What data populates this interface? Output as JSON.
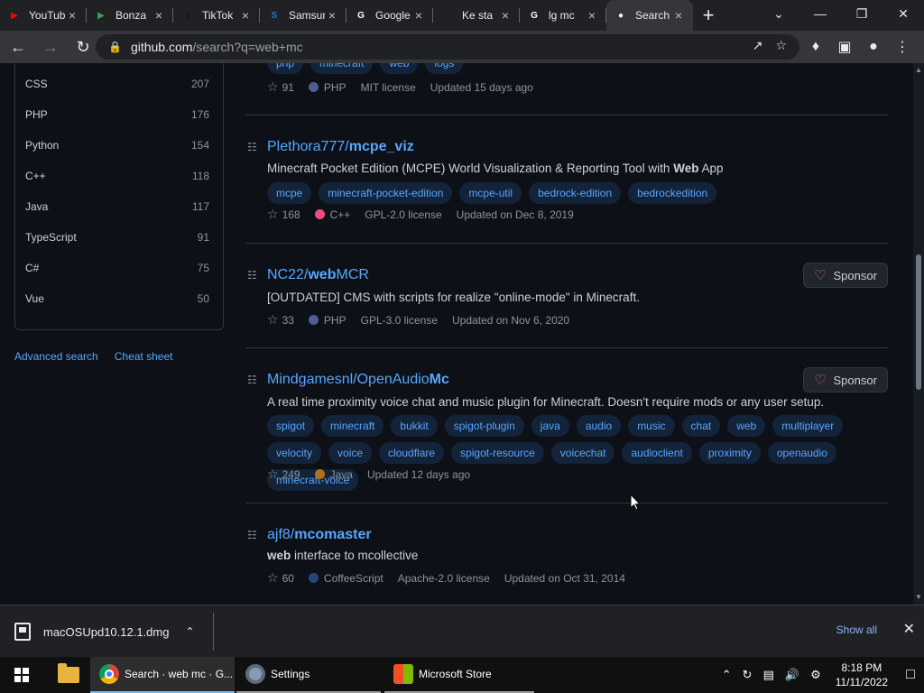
{
  "browser": {
    "tabs": [
      {
        "label": "YouTube",
        "icon": "youtube-icon",
        "color": "#ff0000",
        "glyph": "▶"
      },
      {
        "label": "Bonza",
        "icon": "play-store-icon",
        "color": "#34a853",
        "glyph": "▶"
      },
      {
        "label": "TikTok",
        "icon": "tiktok-icon",
        "color": "#000000",
        "glyph": "♪"
      },
      {
        "label": "Samsung",
        "icon": "samsung-s-icon",
        "color": "#1a73e8",
        "glyph": "S"
      },
      {
        "label": "Google",
        "icon": "google-icon",
        "color": "#ffffff",
        "glyph": "G"
      },
      {
        "label": "Ke sta",
        "icon": "apple-icon",
        "color": "#9aa0a6",
        "glyph": ""
      },
      {
        "label": "lg mc",
        "icon": "google-icon",
        "color": "#ffffff",
        "glyph": "G"
      },
      {
        "label": "Search",
        "icon": "github-icon",
        "color": "#ffffff",
        "glyph": "●"
      }
    ],
    "close_glyph": "×",
    "new_tab_glyph": "+",
    "window_controls": {
      "dropdown": "⌄",
      "minimize": "—",
      "maximize": "❐",
      "close": "✕"
    },
    "url_host": "github.com",
    "url_path": "/search?q=web+mc"
  },
  "sidebar": {
    "languages": [
      {
        "name": "CSS",
        "count": "207"
      },
      {
        "name": "PHP",
        "count": "176"
      },
      {
        "name": "Python",
        "count": "154"
      },
      {
        "name": "C++",
        "count": "118"
      },
      {
        "name": "Java",
        "count": "117"
      },
      {
        "name": "TypeScript",
        "count": "91"
      },
      {
        "name": "C#",
        "count": "75"
      },
      {
        "name": "Vue",
        "count": "50"
      }
    ],
    "advanced_search": "Advanced search",
    "cheat_sheet": "Cheat sheet"
  },
  "results": {
    "sponsor_label": "Sponsor",
    "top_partial": {
      "topics": [
        "php",
        "minecraft",
        "web",
        "logs"
      ],
      "stars": "91",
      "language": "PHP",
      "language_color": "#4f5d95",
      "license": "MIT license",
      "updated": "Updated 15 days ago"
    },
    "repos": [
      {
        "owner": "Plethora777/",
        "name": "mcpe_viz",
        "desc_pre": "Minecraft Pocket Edition (MCPE) World Visualization & Reporting Tool with ",
        "desc_bold": "Web",
        "desc_post": " App",
        "topics": [
          "mcpe",
          "minecraft-pocket-edition",
          "mcpe-util",
          "bedrock-edition",
          "bedrockedition"
        ],
        "stars": "168",
        "language": "C++",
        "language_color": "#f34b7d",
        "license": "GPL-2.0 license",
        "updated": "Updated on Dec 8, 2019"
      },
      {
        "owner": "NC22/",
        "name_bold": "web",
        "name_rest": "MCR",
        "desc": "[OUTDATED] CMS with scripts for realize \"online-mode\" in Minecraft.",
        "stars": "33",
        "language": "PHP",
        "language_color": "#4f5d95",
        "license": "GPL-3.0 license",
        "updated": "Updated on Nov 6, 2020"
      },
      {
        "owner": "Mindgamesnl/",
        "name_rest": "OpenAudio",
        "name_bold": "Mc",
        "desc": "A real time proximity voice chat and music plugin for Minecraft. Doesn't require mods or any user setup.",
        "topics": [
          "spigot",
          "minecraft",
          "bukkit",
          "spigot-plugin",
          "java",
          "audio",
          "music",
          "chat",
          "web",
          "multiplayer",
          "velocity",
          "voice",
          "cloudflare",
          "spigot-resource",
          "voicechat",
          "audioclient",
          "proximity",
          "openaudio",
          "minecraft-voice"
        ],
        "stars": "249",
        "language": "Java",
        "language_color": "#b07219",
        "updated": "Updated 12 days ago"
      },
      {
        "owner": "ajf8/",
        "name_bold": "mc",
        "name_rest": "omaster",
        "desc_bold": "web",
        "desc_post": " interface to mcollective",
        "stars": "60",
        "language": "CoffeeScript",
        "language_color": "#244776",
        "license": "Apache-2.0 license",
        "updated": "Updated on Oct 31, 2014"
      }
    ]
  },
  "download_shelf": {
    "filename": "macOSUpd10.12.1.dmg",
    "show_all": "Show all"
  },
  "taskbar": {
    "apps": [
      {
        "label": "Search · web mc · G...",
        "icon": "chrome-icon"
      },
      {
        "label": "Settings",
        "icon": "settings-gear-icon"
      },
      {
        "label": "Microsoft Store",
        "icon": "microsoft-store-icon"
      }
    ],
    "time": "8:18 PM",
    "date": "11/11/2022"
  }
}
